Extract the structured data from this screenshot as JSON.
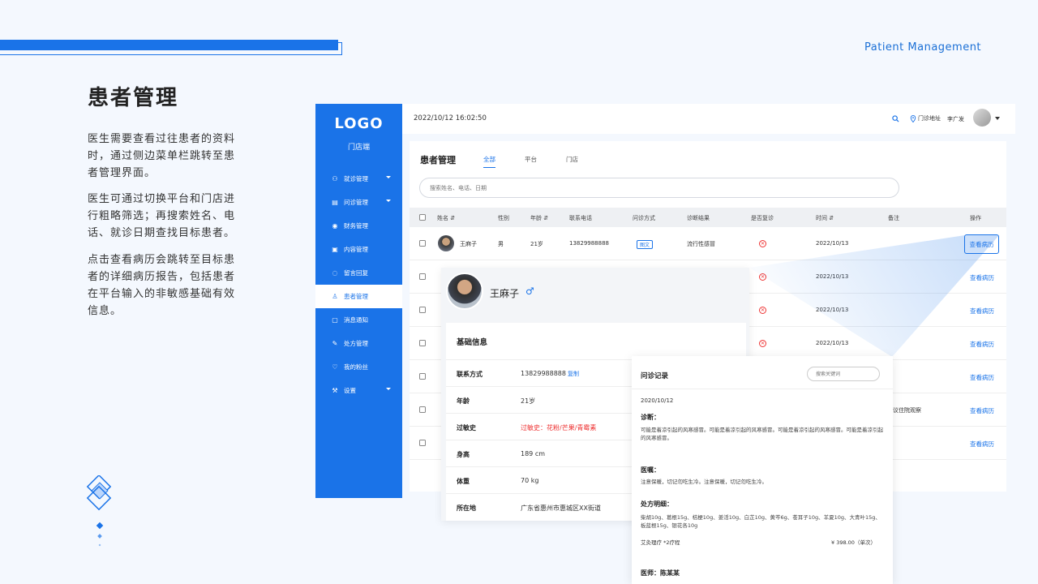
{
  "slide": {
    "brand_en": "Patient Management",
    "title": "患者管理",
    "paragraphs": [
      "医生需要查看过往患者的资料时，通过侧边菜单栏跳转至患者管理界面。",
      "医生可通过切换平台和门店进行粗略筛选；再搜索姓名、电话、就诊日期查找目标患者。",
      "点击查看病历会跳转至目标患者的详细病历报告，包括患者在平台输入的非敏感基础有效信息。"
    ]
  },
  "sidebar": {
    "logo": "LOGO",
    "subtitle": "门店端",
    "items": [
      {
        "label": "就诊管理",
        "icon": "users-icon",
        "caret": true
      },
      {
        "label": "问诊管理",
        "icon": "clipboard-icon",
        "caret": true
      },
      {
        "label": "财务管理",
        "icon": "coin-icon",
        "caret": false
      },
      {
        "label": "内容管理",
        "icon": "document-icon",
        "caret": false
      },
      {
        "label": "留言回复",
        "icon": "chat-icon",
        "caret": false
      },
      {
        "label": "患者管理",
        "icon": "user-icon",
        "caret": false,
        "active": true
      },
      {
        "label": "消息通知",
        "icon": "message-icon",
        "caret": false
      },
      {
        "label": "处方管理",
        "icon": "edit-icon",
        "caret": false
      },
      {
        "label": "我的粉丝",
        "icon": "heart-icon",
        "caret": false
      },
      {
        "label": "设置",
        "icon": "wrench-icon",
        "caret": true
      }
    ]
  },
  "header": {
    "datetime": "2022/10/12  16:02:50",
    "location_label": "门诊地址",
    "username": "李广发"
  },
  "content": {
    "title": "患者管理",
    "tabs": [
      "全部",
      "平台",
      "门店"
    ],
    "search_placeholder": "搜索姓名、电话、日期",
    "columns": [
      "姓名 ⇵",
      "性别",
      "年龄 ⇵",
      "联系电话",
      "问诊方式",
      "诊断结果",
      "是否复诊",
      "时间 ⇵",
      "备注",
      "操作"
    ],
    "first_row": {
      "name": "王麻子",
      "gender": "男",
      "age": "21岁",
      "phone": "13829988888",
      "method": "图文",
      "diagnosis": "流行性感冒",
      "revisit": "✕",
      "date": "2022/10/13",
      "note": "",
      "action": "查看病历"
    },
    "other_rows": [
      {
        "revisit": "✕",
        "date": "2022/10/13",
        "note": "",
        "action": "查看病历"
      },
      {
        "revisit": "✕",
        "date": "2022/10/13",
        "note": "",
        "action": "查看病历"
      },
      {
        "revisit": "✕",
        "date": "2022/10/13",
        "note": "",
        "action": "查看病历"
      },
      {
        "revisit": "",
        "date": "",
        "note": "",
        "action": "查看病历"
      },
      {
        "revisit": "",
        "date": "",
        "note": "议住院观察",
        "action": "查看病历"
      },
      {
        "revisit": "",
        "date": "",
        "note": "",
        "action": "查看病历"
      }
    ]
  },
  "patient": {
    "name": "王麻子",
    "gender_symbol": "♂",
    "section_title": "基础信息",
    "fields": [
      {
        "label": "联系方式",
        "value": "13829988888",
        "extra": "复制"
      },
      {
        "label": "年龄",
        "value": "21岁"
      },
      {
        "label": "过敏史",
        "value": "过敏史：花粉/芒果/青霉素",
        "warn": true
      },
      {
        "label": "身高",
        "value": "189 cm"
      },
      {
        "label": "体重",
        "value": "70 kg"
      },
      {
        "label": "所在地",
        "value": "广东省惠州市惠城区XX街道"
      }
    ]
  },
  "record": {
    "title": "问诊记录",
    "search_placeholder": "搜索关键词",
    "date": "2020/10/12",
    "diagnosis_title": "诊断：",
    "diagnosis_text": "可能是着凉引起的风寒感冒。可能是着凉引起的风寒感冒。可能是着凉引起的风寒感冒。可能是着凉引起的风寒感冒。",
    "advice_title": "医嘱：",
    "advice_text": "注意保暖，切记勿吃生冷。注意保暖，切记勿吃生冷。",
    "prescription_title": "处方明细：",
    "prescription_text": "柴胡10g、葛根15g、桔梗10g、姜活10g、白芷10g、黄芩6g、苍耳子10g、羊夏10g、大青叶15g、板蓝根15g、银花各10g",
    "fee_label": "艾灸理疗  *2疗程",
    "fee_value": "¥ 398.00（单次）",
    "doctor": "医师：陈某某"
  },
  "colors": {
    "accent": "#1a73e8",
    "danger": "#e33333",
    "background": "#f4f8fe"
  }
}
